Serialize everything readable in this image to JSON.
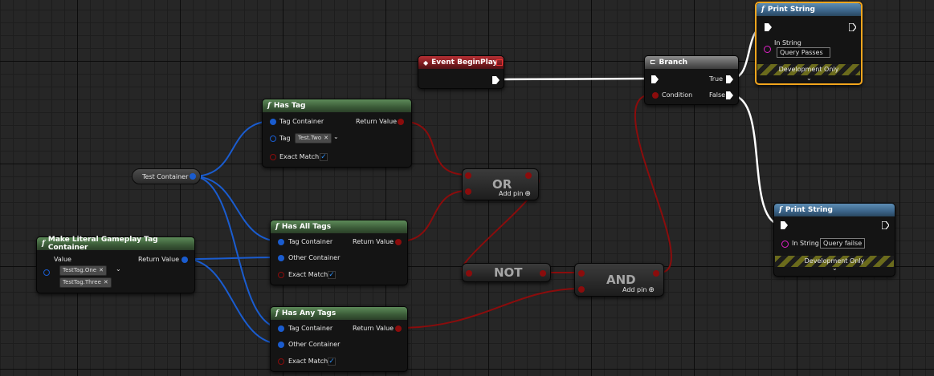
{
  "colors": {
    "struct_pin": "#1a5ccf",
    "bool_pin": "#8b0c0c",
    "string_pin": "#e020c8",
    "exec_wire": "#ffffff",
    "selected_outline": "#f3a51d"
  },
  "icons": {
    "function": "function-icon",
    "event": "event-diamond-icon",
    "branch": "branch-icon",
    "add": "add-pin-icon"
  },
  "nodes": {
    "event_begin_play": {
      "title": "Event BeginPlay"
    },
    "branch": {
      "title": "Branch",
      "true_label": "True",
      "false_label": "False",
      "condition_label": "Condition"
    },
    "print_string_top": {
      "title": "Print String",
      "in_string_label": "In String",
      "in_string_value": "Query  Passes",
      "dev_only": "Development Only"
    },
    "print_string_bottom": {
      "title": "Print String",
      "in_string_label": "In String",
      "in_string_value": "Query failse",
      "dev_only": "Development Only"
    },
    "has_tag": {
      "title": "Has Tag",
      "tag_container": "Tag Container",
      "return_value": "Return Value",
      "tag_label": "Tag",
      "tag_value": "Test.Two",
      "exact_match": "Exact Match"
    },
    "has_all_tags": {
      "title": "Has All Tags",
      "tag_container": "Tag Container",
      "return_value": "Return Value",
      "other_container": "Other Container",
      "exact_match": "Exact Match"
    },
    "has_any_tags": {
      "title": "Has Any Tags",
      "tag_container": "Tag Container",
      "return_value": "Return Value",
      "other_container": "Other Container",
      "exact_match": "Exact Match"
    },
    "make_literal": {
      "title": "Make Literal Gameplay Tag Container",
      "value_label": "Value",
      "return_value": "Return Value",
      "tags": [
        "TestTag.One",
        "TestTag.Three"
      ]
    },
    "test_container": {
      "title": "Test Container"
    },
    "or_node": {
      "title": "OR",
      "add_pin": "Add pin"
    },
    "not_node": {
      "title": "NOT"
    },
    "and_node": {
      "title": "AND",
      "add_pin": "Add pin"
    }
  }
}
